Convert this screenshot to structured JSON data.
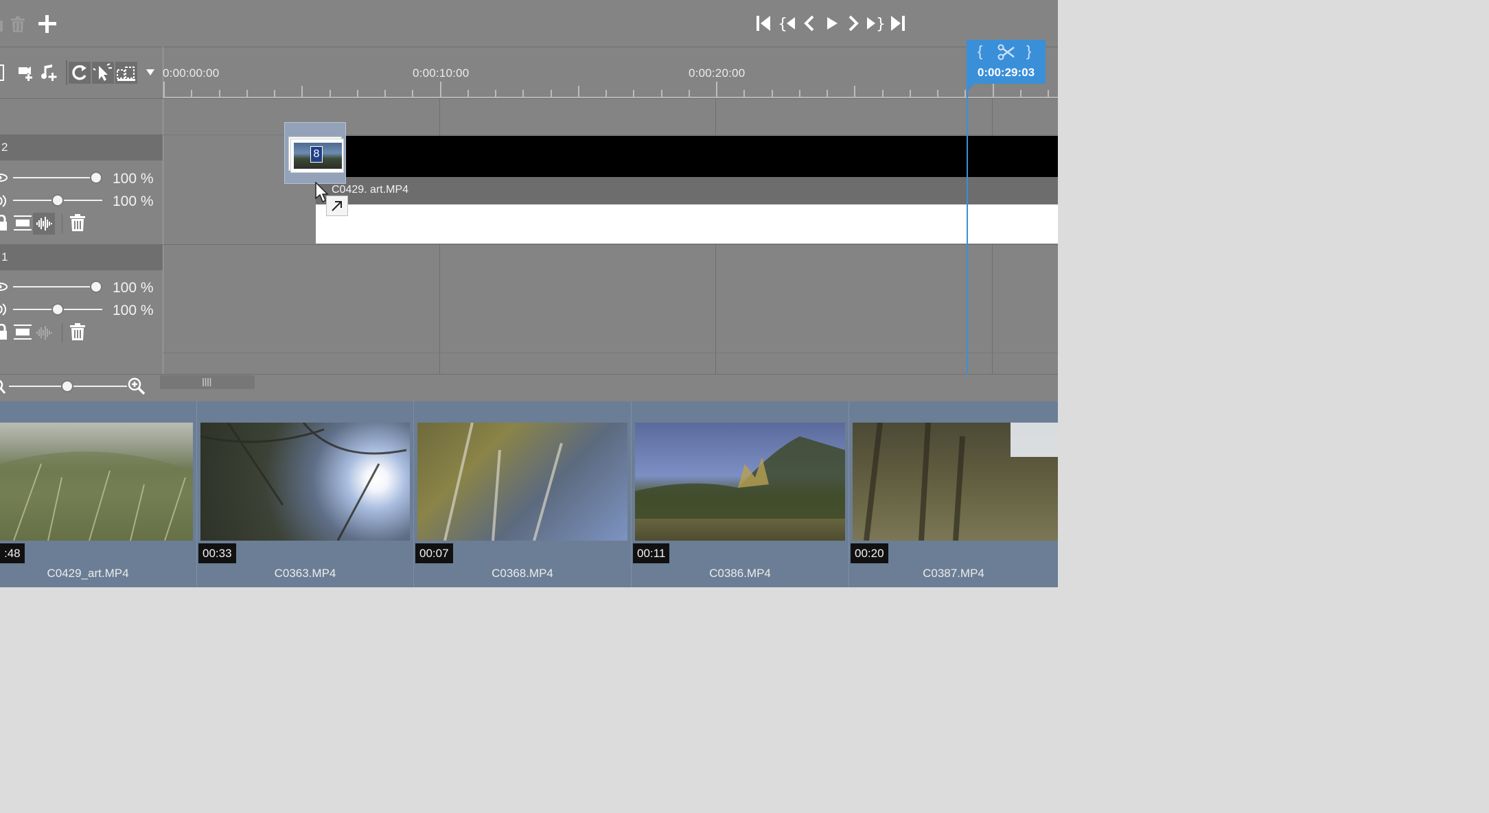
{
  "ruler": {
    "labels": [
      "0:00:00:00",
      "0:00:10:00",
      "0:00:20:00"
    ]
  },
  "playhead": {
    "time": "0:00:29:03",
    "color": "#3a8fd9",
    "in_mark": "{",
    "out_mark": "}"
  },
  "tracks": [
    {
      "label": "2",
      "opacity_value": "100 %",
      "volume_value": "100 %"
    },
    {
      "label": "1",
      "opacity_value": "100 %",
      "volume_value": "100 %"
    }
  ],
  "drag": {
    "badge_count": "8",
    "clip_label": "C0429. art.MP4"
  },
  "media": [
    {
      "duration": ":48",
      "name": "C0429_art.MP4"
    },
    {
      "duration": "00:33",
      "name": "C0363.MP4"
    },
    {
      "duration": "00:07",
      "name": "C0368.MP4"
    },
    {
      "duration": "00:11",
      "name": "C0386.MP4"
    },
    {
      "duration": "00:20",
      "name": "C0387.MP4"
    }
  ],
  "icons": {
    "toolbar": [
      "delete-icon",
      "trash-icon",
      "add-icon"
    ],
    "transport": [
      "go-to-start-icon",
      "previous-marker-icon",
      "previous-frame-icon",
      "play-icon",
      "next-frame-icon",
      "next-marker-icon",
      "go-to-end-icon"
    ],
    "timeline_tools": [
      "add-video-track-icon",
      "add-audio-track-icon",
      "ripple-icon",
      "magnet-select-icon",
      "trim-icon",
      "dropdown-arrow-icon"
    ]
  },
  "colors": {
    "workspace": "#848484",
    "media_bin": "#6b7e95",
    "track_header": "#6f6f6f",
    "accent": "#3a8fd9"
  }
}
